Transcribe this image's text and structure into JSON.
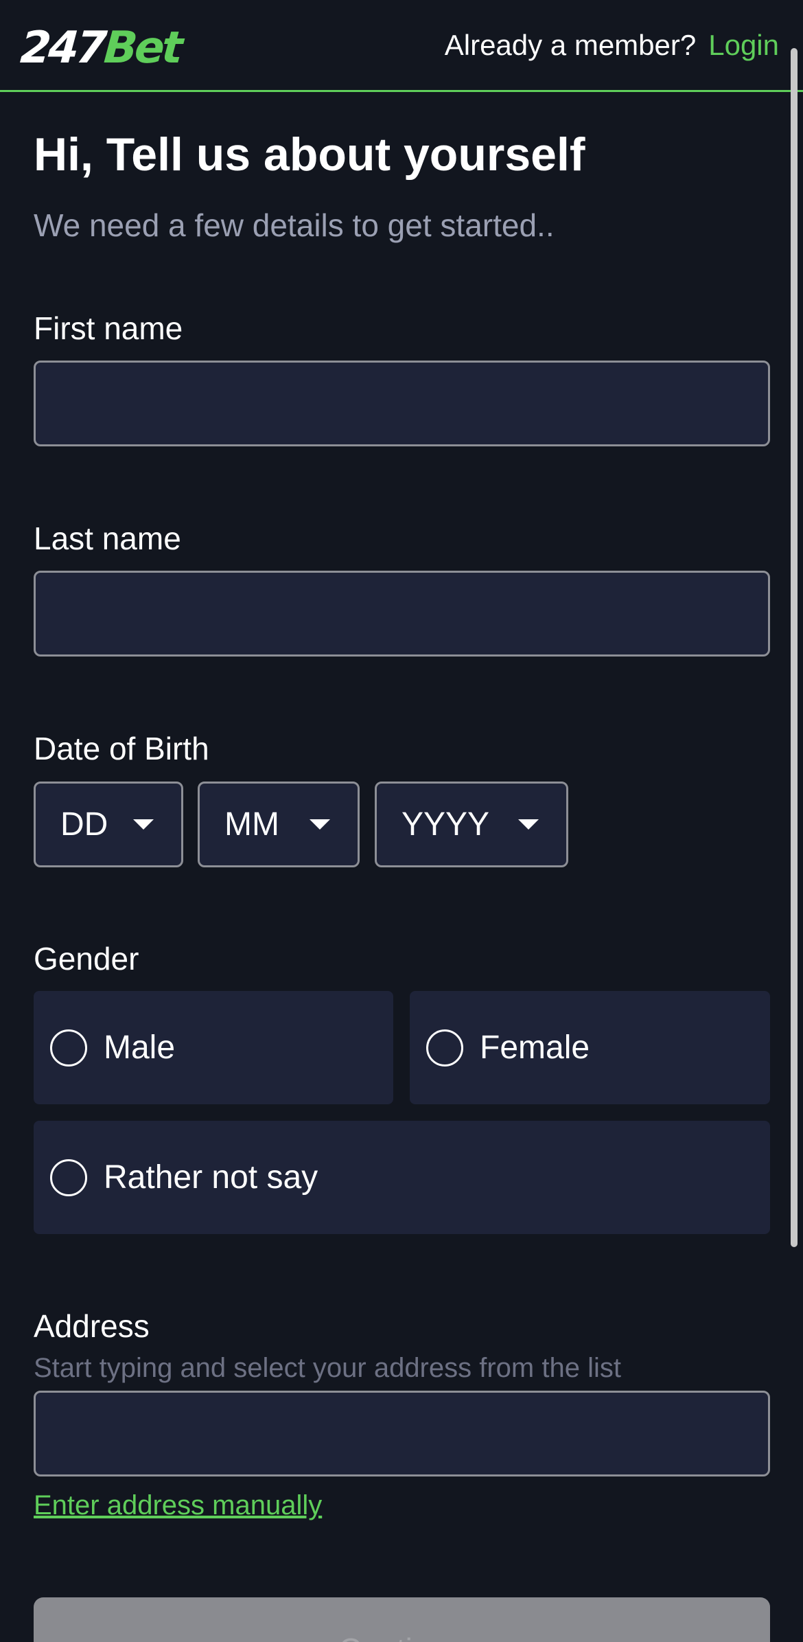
{
  "header": {
    "logo_num": "247",
    "logo_brand": "Bet",
    "member_question": "Already a member?",
    "login_label": "Login"
  },
  "intro": {
    "title": "Hi, Tell us about yourself",
    "subtitle": "We need a few details to get started.."
  },
  "form": {
    "first_name_label": "First name",
    "first_name_value": "",
    "last_name_label": "Last name",
    "last_name_value": "",
    "dob_label": "Date of Birth",
    "dob_day": "DD",
    "dob_month": "MM",
    "dob_year": "YYYY",
    "gender_label": "Gender",
    "gender_options": [
      "Male",
      "Female",
      "Rather not say"
    ],
    "address_label": "Address",
    "address_hint": "Start typing and select your address from the list",
    "address_value": "",
    "manual_address_link": "Enter address manually",
    "continue_label": "Continue"
  },
  "colors": {
    "background": "#12161f",
    "field": "#1e2338",
    "accent": "#5fce5a",
    "muted": "#9ba0b3"
  },
  "icons": [
    "caret-down-icon",
    "radio-unchecked-icon"
  ]
}
